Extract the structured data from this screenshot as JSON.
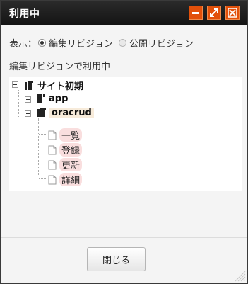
{
  "dialog": {
    "title": "利用中",
    "buttons": {
      "minimize": "minimize-icon",
      "maximize": "maximize-icon",
      "close": "close-icon"
    }
  },
  "display": {
    "label": "表示：",
    "options": [
      {
        "label": "編集リビジョン",
        "checked": true
      },
      {
        "label": "公開リビジョン",
        "checked": false
      }
    ]
  },
  "status_text": "編集リビジョンで利用中",
  "tree": {
    "root": {
      "label": "サイト初期",
      "expanded": true
    },
    "children": [
      {
        "label": "app",
        "expanded": false
      },
      {
        "label": "oracrud",
        "expanded": true,
        "selected": true
      }
    ],
    "leaves": [
      "一覧",
      "登録",
      "更新",
      "詳細"
    ]
  },
  "footer": {
    "close_label": "閉じる"
  },
  "colors": {
    "titlebar": "#1c1c1c",
    "title_button": "#e2500a",
    "leaf_highlight": "#f9dede",
    "selected_highlight": "#f7ebda"
  }
}
